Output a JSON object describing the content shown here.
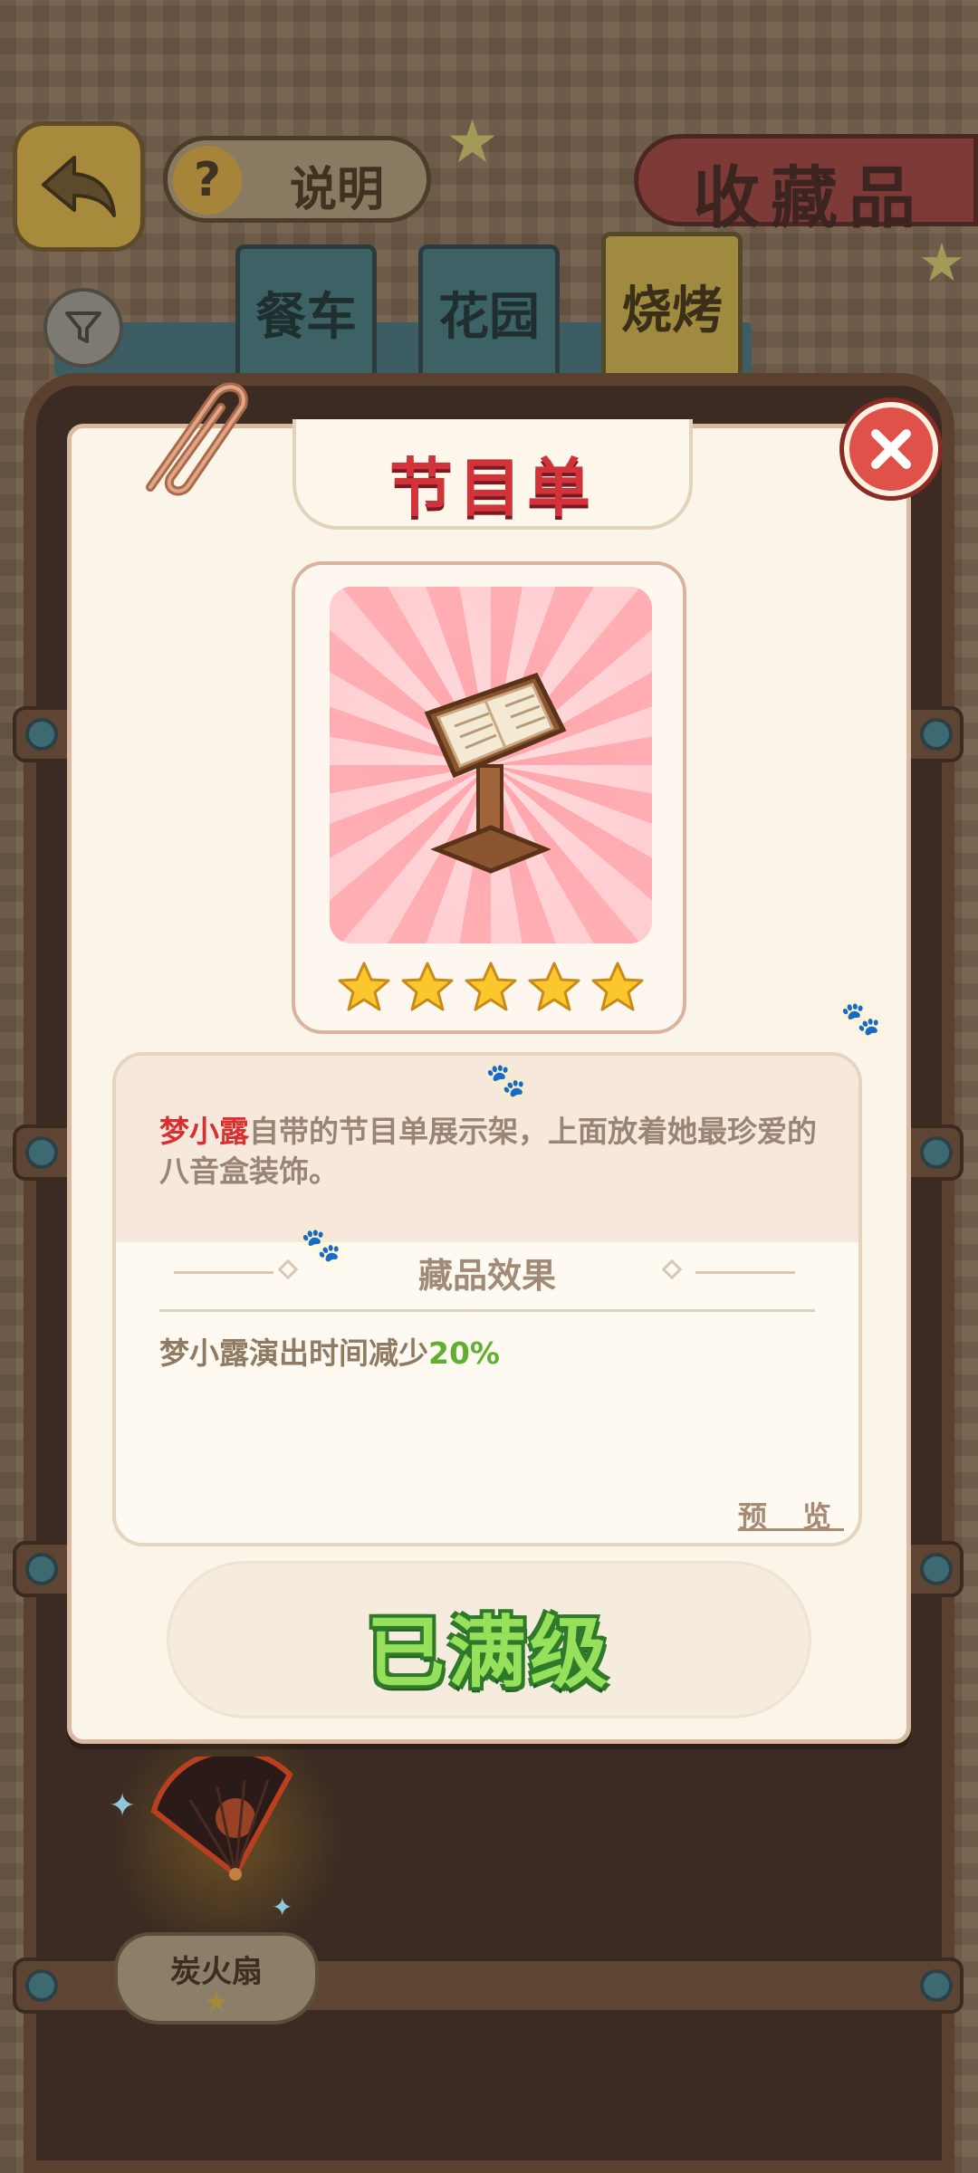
{
  "header": {
    "help_label": "说明",
    "help_icon": "question-icon",
    "collection_title": "收藏品"
  },
  "tabs": [
    {
      "label": "餐车"
    },
    {
      "label": "花园"
    },
    {
      "label": "烧烤"
    }
  ],
  "active_tab": "烧烤",
  "shelf_item": {
    "label": "炭火扇",
    "stars": 1
  },
  "modal": {
    "title": "节目单",
    "rating_stars": 5,
    "description_name": "梦小露",
    "description_rest": "自带的节目单展示架，上面放着她最珍爱的八音盒装饰。",
    "effect_heading": "藏品效果",
    "effect_prefix": "梦小露演出时间减少",
    "effect_value": "20%",
    "preview_label": "预 览",
    "status_label": "已满级"
  },
  "colors": {
    "accent_red": "#d2333a",
    "max_green": "#96e05c",
    "effect_green": "#5fb02f"
  }
}
